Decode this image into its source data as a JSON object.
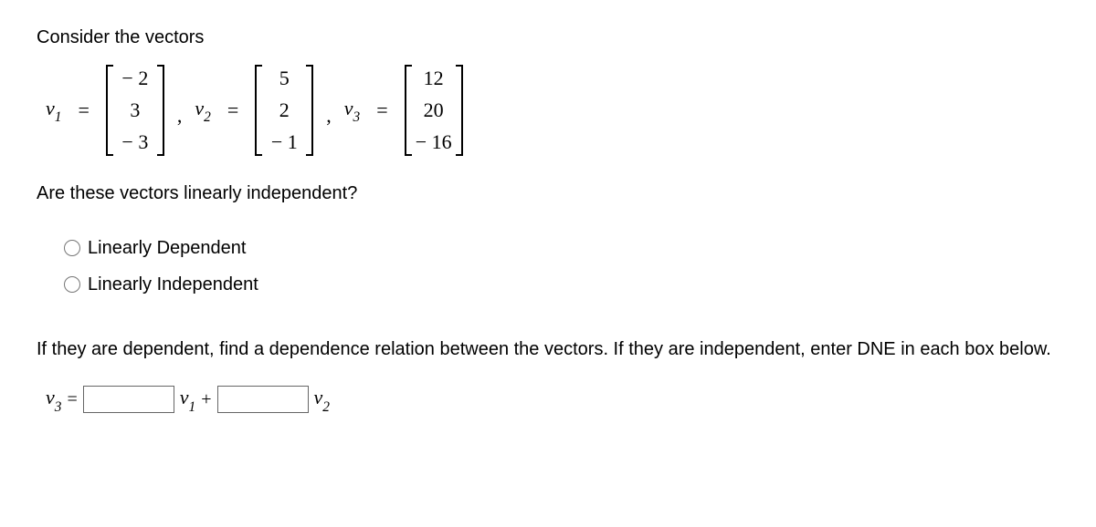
{
  "intro": "Consider the vectors",
  "vectors": {
    "v1": {
      "name": "v",
      "sub": "1",
      "entries": [
        "− 2",
        "3",
        "− 3"
      ]
    },
    "v2": {
      "name": "v",
      "sub": "2",
      "entries": [
        "5",
        "2",
        "− 1"
      ]
    },
    "v3": {
      "name": "v",
      "sub": "3",
      "entries": [
        "12",
        "20",
        "− 16"
      ]
    }
  },
  "question": "Are these vectors linearly independent?",
  "choices": {
    "dependent": "Linearly Dependent",
    "independent": "Linearly Independent"
  },
  "instruction": "If they are dependent, find a dependence relation between the vectors. If they are independent, enter DNE in each box below.",
  "relation": {
    "lhs_name": "v",
    "lhs_sub": "3",
    "eq": "=",
    "term1_name": "v",
    "term1_sub": "1",
    "plus": "+",
    "term2_name": "v",
    "term2_sub": "2",
    "input1": "",
    "input2": ""
  }
}
